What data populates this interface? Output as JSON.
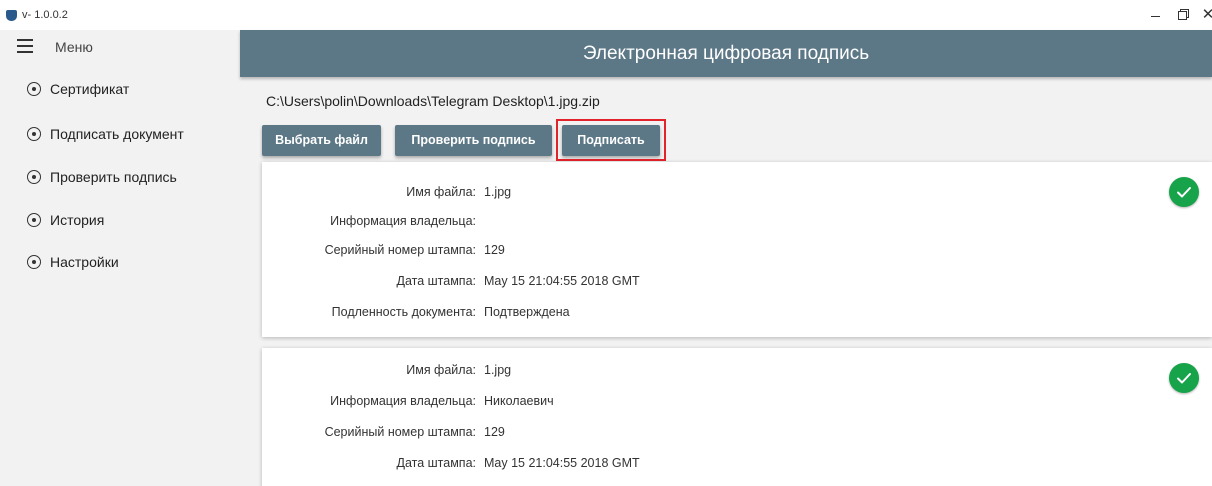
{
  "titlebar": {
    "version": "v- 1.0.0.2"
  },
  "sidebar": {
    "menu_label": "Меню",
    "items": [
      {
        "label": "Сертификат"
      },
      {
        "label": "Подписать документ"
      },
      {
        "label": "Проверить подпись"
      },
      {
        "label": "История"
      },
      {
        "label": "Настройки"
      }
    ]
  },
  "main": {
    "title": "Электронная цифровая подпись",
    "file_path": "C:\\Users\\polin\\Downloads\\Telegram Desktop\\1.jpg.zip",
    "buttons": {
      "select_file": "Выбрать файл",
      "verify_signature": "Проверить подпись",
      "sign": "Подписать"
    },
    "results": [
      {
        "rows": [
          {
            "label": "Имя файла:",
            "value": "1.jpg"
          },
          {
            "label": "Информация владельца:",
            "value": ""
          },
          {
            "label": "Серийный номер штампа:",
            "value": "129"
          },
          {
            "label": "Дата штампа:",
            "value": "May 15 21:04:55 2018 GMT"
          },
          {
            "label": "Подленность документа:",
            "value": "Подтверждена"
          }
        ],
        "status_icon": "check-circle-icon",
        "status_color": "#16a34a"
      },
      {
        "rows": [
          {
            "label": "Имя файла:",
            "value": "1.jpg"
          },
          {
            "label": "Информация владельца:",
            "value": "Николаевич"
          },
          {
            "label": "Серийный номер штампа:",
            "value": "129"
          },
          {
            "label": "Дата штампа:",
            "value": "May 15 21:04:55 2018 GMT"
          }
        ],
        "status_icon": "check-circle-icon",
        "status_color": "#16a34a"
      }
    ]
  },
  "colors": {
    "header": "#5c7887",
    "highlight": "#e3232b",
    "success": "#16a34a"
  }
}
